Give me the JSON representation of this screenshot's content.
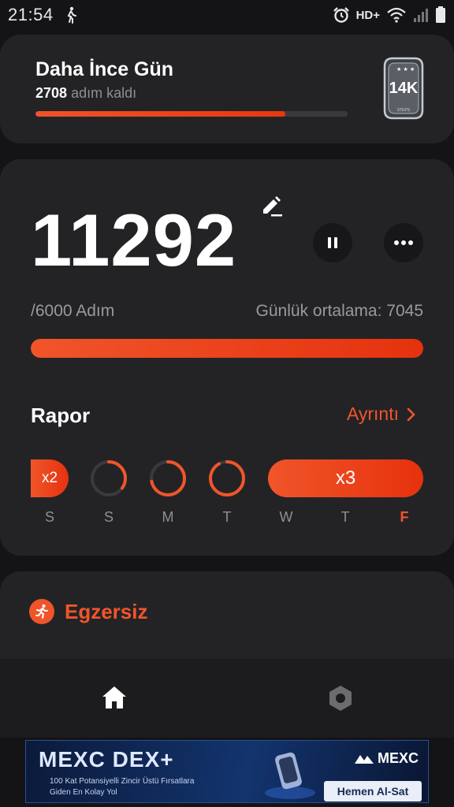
{
  "status_bar": {
    "time": "21:54",
    "network": "HD+",
    "icons": [
      "walk-icon",
      "alarm-icon",
      "wifi-icon",
      "signal-icon",
      "battery-icon"
    ]
  },
  "goal_card": {
    "title": "Daha İnce Gün",
    "steps_left": "2708",
    "steps_left_suffix": "adım kaldı",
    "progress_fraction": 0.8,
    "badge_label": "14K",
    "badge_caption": "STEPS"
  },
  "step_card": {
    "step_count": "11292",
    "goal_label": "/6000 Adım",
    "daily_average_label": "Günlük ortalama: 7045",
    "progress_fraction": 1.0
  },
  "report": {
    "title": "Rapor",
    "details_link": "Ayrıntı",
    "streak_left": "x2",
    "streak_right": "x3",
    "ring_progress": [
      0.35,
      0.72,
      0.92
    ],
    "days": [
      "S",
      "S",
      "M",
      "T",
      "W",
      "T",
      "F"
    ],
    "active_day_index": 6
  },
  "exercise": {
    "title": "Egzersiz"
  },
  "bottom_nav": {
    "items": [
      "home-icon",
      "settings-icon"
    ]
  },
  "ad": {
    "title": "MEXC DEX+",
    "line1": "100 Kat Potansiyelli Zincir Üstü Fırsatlara",
    "line2": "Giden En Kolay Yol",
    "brand": "MEXC",
    "cta": "Hemen Al-Sat"
  },
  "colors": {
    "accent": "#f0552a",
    "card": "#232326",
    "background": "#141416"
  }
}
